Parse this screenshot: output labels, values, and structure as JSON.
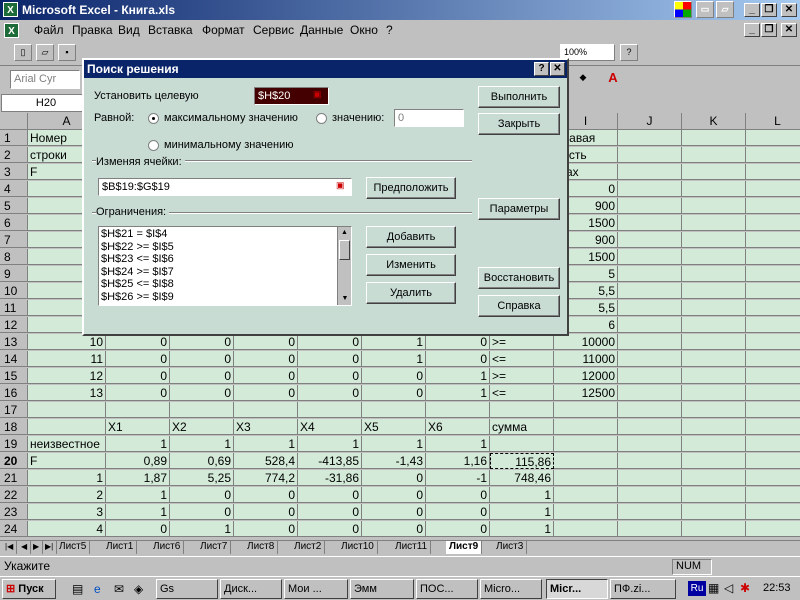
{
  "window": {
    "title": "Microsoft Excel - Книга.xls",
    "icon_label": "X"
  },
  "menu": [
    "Файл",
    "Правка",
    "Вид",
    "Вставка",
    "Формат",
    "Сервис",
    "Данные",
    "Окно",
    "?"
  ],
  "toolbar": {
    "zoom": "100%",
    "font_name": "Arial Cyr"
  },
  "formula_bar": {
    "name_box": "H20"
  },
  "columns": [
    "A",
    "B",
    "C",
    "D",
    "E",
    "F",
    "G",
    "H",
    "I",
    "J",
    "K",
    "L"
  ],
  "rows": [
    {
      "n": "1",
      "cells": [
        "Номер",
        "",
        "",
        "",
        "",
        "",
        "",
        "",
        "правая"
      ]
    },
    {
      "n": "2",
      "cells": [
        "строки",
        "",
        "",
        "",
        "",
        "",
        "",
        "",
        "часть"
      ]
    },
    {
      "n": "3",
      "cells": [
        "F",
        "",
        "",
        "",
        "",
        "",
        "",
        "",
        "max"
      ]
    },
    {
      "n": "4",
      "cells": [
        "",
        "",
        "",
        "",
        "",
        "",
        "",
        "",
        "0"
      ]
    },
    {
      "n": "5",
      "cells": [
        "",
        "",
        "",
        "",
        "",
        "",
        "",
        "",
        "900"
      ]
    },
    {
      "n": "6",
      "cells": [
        "",
        "",
        "",
        "",
        "",
        "",
        "",
        "",
        "1500"
      ]
    },
    {
      "n": "7",
      "cells": [
        "",
        "",
        "",
        "",
        "",
        "",
        "",
        "",
        "900"
      ]
    },
    {
      "n": "8",
      "cells": [
        "",
        "",
        "",
        "",
        "",
        "",
        "",
        "",
        "1500"
      ]
    },
    {
      "n": "9",
      "cells": [
        "",
        "",
        "",
        "",
        "",
        "",
        "",
        "",
        "5"
      ]
    },
    {
      "n": "10",
      "cells": [
        "",
        "",
        "",
        "",
        "",
        "",
        "",
        "",
        "5,5"
      ]
    },
    {
      "n": "11",
      "cells": [
        "",
        "",
        "",
        "",
        "",
        "",
        "",
        "",
        "5,5"
      ]
    },
    {
      "n": "12",
      "cells": [
        "",
        "",
        "",
        "",
        "",
        "",
        "",
        "",
        "6"
      ]
    },
    {
      "n": "13",
      "cells": [
        "10",
        "0",
        "0",
        "0",
        "0",
        "1",
        "0",
        ">=",
        "10000"
      ]
    },
    {
      "n": "14",
      "cells": [
        "11",
        "0",
        "0",
        "0",
        "0",
        "1",
        "0",
        "<=",
        "11000"
      ]
    },
    {
      "n": "15",
      "cells": [
        "12",
        "0",
        "0",
        "0",
        "0",
        "0",
        "1",
        ">=",
        "12000"
      ]
    },
    {
      "n": "16",
      "cells": [
        "13",
        "0",
        "0",
        "0",
        "0",
        "0",
        "1",
        "<=",
        "12500"
      ]
    },
    {
      "n": "17",
      "cells": [
        "",
        "",
        "",
        "",
        "",
        "",
        "",
        "",
        ""
      ]
    },
    {
      "n": "18",
      "cells": [
        "",
        "X1",
        "X2",
        "X3",
        "X4",
        "X5",
        "X6",
        "сумма",
        ""
      ]
    },
    {
      "n": "19",
      "cells": [
        "неизвестное",
        "1",
        "1",
        "1",
        "1",
        "1",
        "1",
        "",
        ""
      ]
    },
    {
      "n": "20",
      "cells": [
        "F",
        "0,89",
        "0,69",
        "528,4",
        "-413,85",
        "-1,43",
        "1,16",
        "115,86",
        ""
      ]
    },
    {
      "n": "21",
      "cells": [
        "1",
        "1,87",
        "5,25",
        "774,2",
        "-31,86",
        "0",
        "-1",
        "748,46",
        ""
      ]
    },
    {
      "n": "22",
      "cells": [
        "2",
        "1",
        "0",
        "0",
        "0",
        "0",
        "0",
        "1",
        ""
      ]
    },
    {
      "n": "23",
      "cells": [
        "3",
        "1",
        "0",
        "0",
        "0",
        "0",
        "0",
        "1",
        ""
      ]
    },
    {
      "n": "24",
      "cells": [
        "4",
        "0",
        "1",
        "0",
        "0",
        "0",
        "0",
        "1",
        ""
      ]
    }
  ],
  "dialog": {
    "title": "Поиск решения",
    "target_label": "Установить целевую",
    "target_value": "$H$20",
    "equal_label": "Равной:",
    "radio_max": "максимальному значению",
    "radio_value": "значению:",
    "value_input": "0",
    "radio_min": "минимальному значению",
    "changing_label": "Изменяя ячейки:",
    "changing_value": "$B$19:$G$19",
    "guess_btn": "Предположить",
    "constraints_label": "Ограничения:",
    "constraints": [
      "$H$21 = $I$4",
      "$H$22 >= $I$5",
      "$H$23 <= $I$6",
      "$H$24 >= $I$7",
      "$H$25 <= $I$8",
      "$H$26 >= $I$9"
    ],
    "add_btn": "Добавить",
    "change_btn": "Изменить",
    "delete_btn": "Удалить",
    "run_btn": "Выполнить",
    "close_btn": "Закрыть",
    "params_btn": "Параметры",
    "restore_btn": "Восстановить",
    "help_btn": "Справка"
  },
  "sheet_tabs": [
    "Лист5",
    "Лист1",
    "Лист6",
    "Лист7",
    "Лист8",
    "Лист2",
    "Лист10",
    "Лист11",
    "Лист9",
    "Лист3"
  ],
  "active_tab": "Лист9",
  "status": {
    "text": "Укажите",
    "num": "NUM"
  },
  "taskbar": {
    "start": "Пуск",
    "tasks": [
      "Gs",
      "Диск...",
      "Мои ...",
      "Эмм",
      "ПОС...",
      "Micro...",
      "Micr...",
      "ПФ.zi..."
    ],
    "active_task": 6,
    "lang": "Ru",
    "clock": "22:53"
  }
}
